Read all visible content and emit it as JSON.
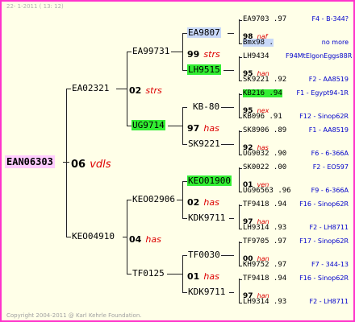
{
  "header": "22-  1-2011 ( 13: 12)",
  "footer": "Copyright 2004-2011 @ Karl Kehrle Foundation.",
  "root": {
    "id": "EAN06303",
    "num": "06",
    "name": "vdls"
  },
  "gen1": [
    {
      "id": "EA02321",
      "num": "02",
      "name": "strs"
    },
    {
      "id": "KEO04910",
      "num": "04",
      "name": "has"
    }
  ],
  "gen2": [
    {
      "id": "EA99731",
      "num": "99",
      "name": "strs"
    },
    {
      "id": "UG9714",
      "num": "97",
      "name": "has"
    },
    {
      "id": "KEO02906",
      "num": "02",
      "name": "has"
    },
    {
      "id": "TF0125",
      "num": "01",
      "name": "has"
    }
  ],
  "gen3": [
    {
      "id": "EA9807"
    },
    {
      "id": "LH9515"
    },
    {
      "id": "KB-80"
    },
    {
      "id": "SK9221"
    },
    {
      "id": "KEO01900"
    },
    {
      "id": "KDK9711"
    },
    {
      "id": "TF0030"
    },
    {
      "id": "KDK9711"
    }
  ],
  "gen3_mid": [
    {
      "num": "98",
      "name": "naf"
    },
    {
      "num": "95",
      "name": "han"
    },
    {
      "num": "95",
      "name": "nex"
    },
    {
      "num": "92",
      "name": "has"
    },
    {
      "num": "01",
      "name": "ven"
    },
    {
      "num": "97",
      "name": "han"
    },
    {
      "num": "00",
      "name": "han"
    },
    {
      "num": "97",
      "name": "han"
    }
  ],
  "gen4": [
    {
      "id": "EA9703 .97",
      "note": "F4 - B-344?"
    },
    {
      "id": "Bmx98 .",
      "note": "no more"
    },
    {
      "id": "LH9434",
      "note": "F94MtElgonEggs88R"
    },
    {
      "id": "SK9221 .92",
      "note": "F2 - AA8519"
    },
    {
      "id": "KB216 .94",
      "note": "F1 - Egypt94-1R"
    },
    {
      "id": "KB096 .91",
      "note": "F12 - Sinop62R"
    },
    {
      "id": "SK8906 .89",
      "note": "F1 - AA8519"
    },
    {
      "id": "UG9032 .90",
      "note": "F6 - 6-366A"
    },
    {
      "id": "SK0022 .00",
      "note": "F2 - EO597"
    },
    {
      "id": "UG96563 .96",
      "note": "F9 - 6-366A"
    },
    {
      "id": "TF9418 .94",
      "note": "F16 - Sinop62R"
    },
    {
      "id": "LH9314 .93",
      "note": "F2 - LH8711"
    },
    {
      "id": "TF9705 .97",
      "note": "F17 - Sinop62R"
    },
    {
      "id": "KH9752 .97",
      "note": "F7 - 344-13"
    },
    {
      "id": "TF9418 .94",
      "note": "F16 - Sinop62R"
    },
    {
      "id": "LH9314 .93",
      "note": "F2 - LH8711"
    }
  ],
  "colors": {
    "border": "#ff33cc",
    "background": "#ffffe8",
    "highlight_green": "#33ee33",
    "highlight_root": "#ffccff",
    "name_red": "#dd0000",
    "note_blue": "#0000cc"
  }
}
